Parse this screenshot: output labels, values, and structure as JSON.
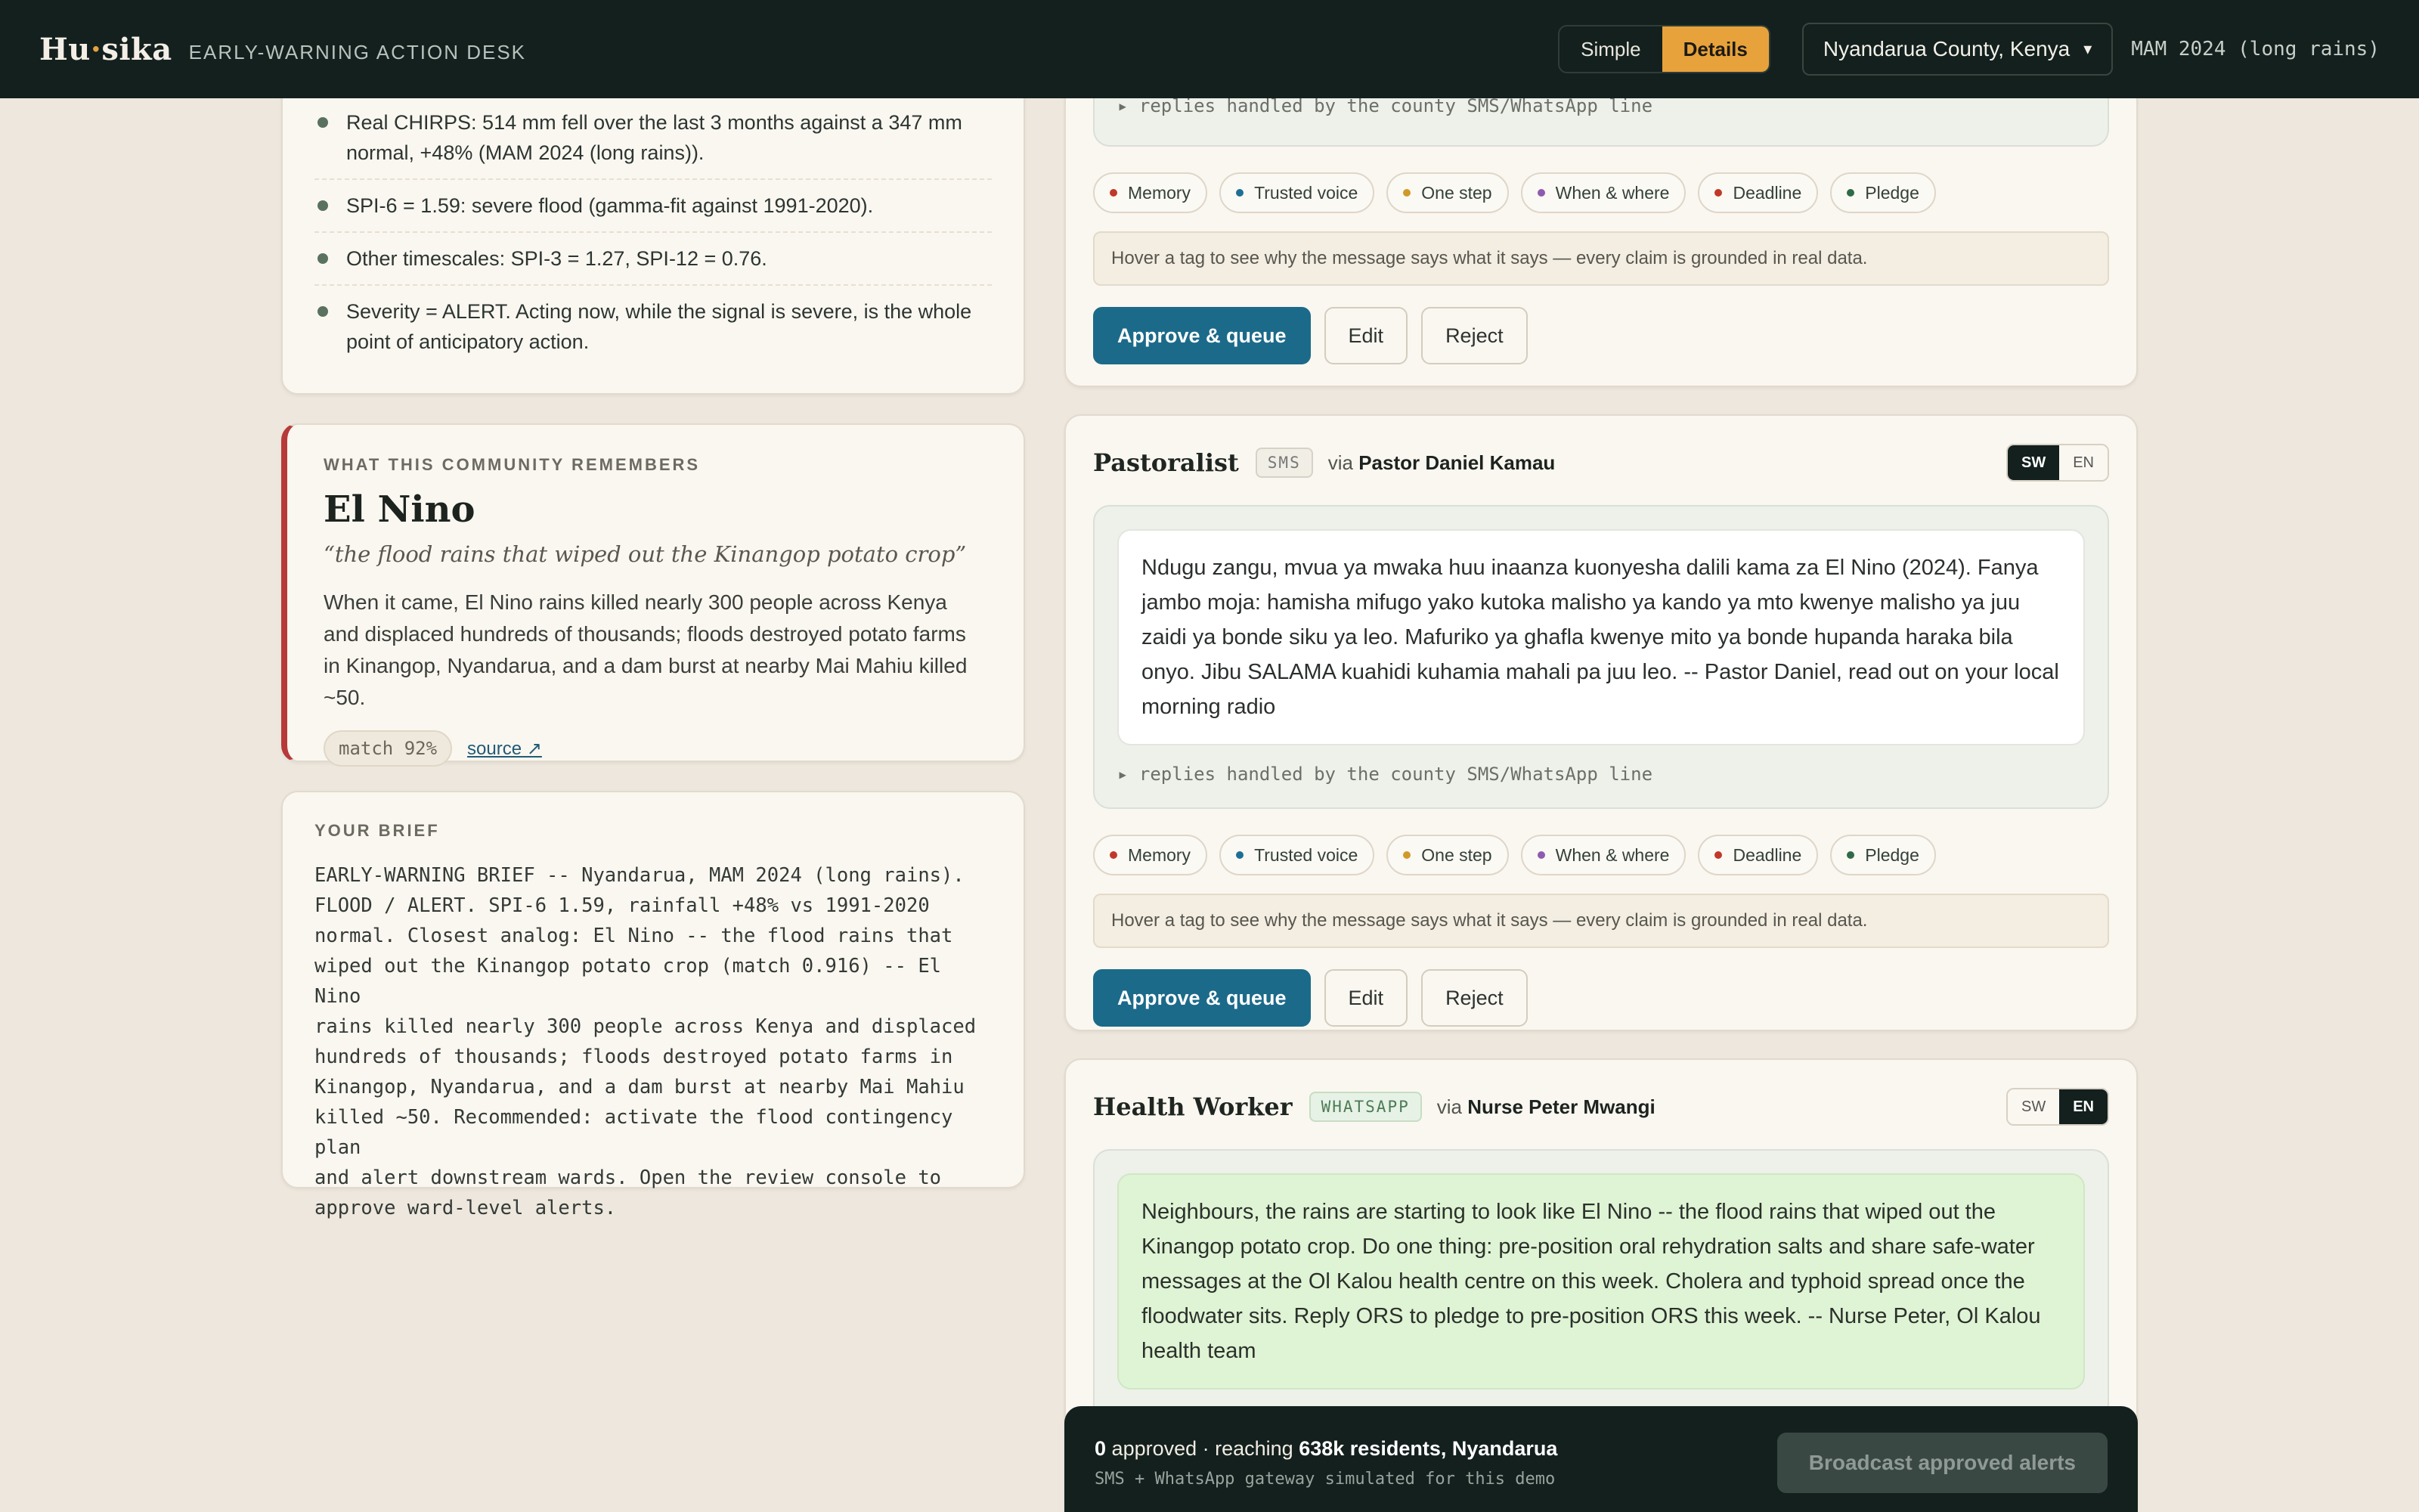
{
  "topbar": {
    "logo_a": "Hu",
    "logo_dot": "·",
    "logo_b": "sika",
    "subtitle": "EARLY-WARNING ACTION DESK",
    "mode_simple": "Simple",
    "mode_details": "Details",
    "region": "Nyandarua County, Kenya",
    "season": "MAM 2024 (long rains)"
  },
  "facts": [
    "Real CHIRPS: 514 mm fell over the last 3 months against a 347 mm normal, +48% (MAM 2024 (long rains)).",
    "SPI-6 = 1.59: severe flood (gamma-fit against 1991-2020).",
    "Other timescales: SPI-3 = 1.27, SPI-12 = 0.76.",
    "Severity = ALERT. Acting now, while the signal is severe, is the whole point of anticipatory action."
  ],
  "memory": {
    "kicker": "WHAT THIS COMMUNITY REMEMBERS",
    "title": "El Nino",
    "quote": "“the flood rains that wiped out the Kinangop potato crop”",
    "body": "When it came, El Nino rains killed nearly 300 people across Kenya and displaced hundreds of thousands; floods destroyed potato farms in Kinangop, Nyandarua, and a dam burst at nearby Mai Mahiu killed ~50.",
    "match": "match 92%",
    "source": "source ↗"
  },
  "brief": {
    "kicker": "YOUR BRIEF",
    "text": "EARLY-WARNING BRIEF -- Nyandarua, MAM 2024 (long rains).\nFLOOD / ALERT. SPI-6 1.59, rainfall +48% vs 1991-2020\nnormal. Closest analog: El Nino -- the flood rains that\nwiped out the Kinangop potato crop (match 0.916) -- El Nino\nrains killed nearly 300 people across Kenya and displaced\nhundreds of thousands; floods destroyed potato farms in\nKinangop, Nyandarua, and a dam burst at nearby Mai Mahiu\nkilled ~50. Recommended: activate the flood contingency plan\nand alert downstream wards. Open the review console to\napprove ward-level alerts."
  },
  "common": {
    "replies": "▸ replies handled by the county SMS/WhatsApp line",
    "hint": "Hover a tag to see why the message says what it says — every claim is grounded in real data.",
    "approve": "Approve & queue",
    "edit": "Edit",
    "reject": "Reject",
    "via": "via",
    "lang_sw": "SW",
    "lang_en": "EN",
    "tags": [
      {
        "label": "Memory",
        "color": "#c0392b"
      },
      {
        "label": "Trusted voice",
        "color": "#1f6f95"
      },
      {
        "label": "One step",
        "color": "#d09a2a"
      },
      {
        "label": "When & where",
        "color": "#8e5bb0"
      },
      {
        "label": "Deadline",
        "color": "#c0392b"
      },
      {
        "label": "Pledge",
        "color": "#2e6b4a"
      }
    ]
  },
  "pastoralist": {
    "role": "Pastoralist",
    "channel": "SMS",
    "messenger": "Pastor Daniel Kamau",
    "message": "Ndugu zangu, mvua ya mwaka huu inaanza kuonyesha dalili kama za El Nino (2024). Fanya jambo moja: hamisha mifugo yako kutoka malisho ya kando ya mto kwenye malisho ya juu zaidi ya bonde siku ya leo. Mafuriko ya ghafla kwenye mito ya bonde hupanda haraka bila onyo. Jibu SALAMA kuahidi kuhamia mahali pa juu leo. -- Pastor Daniel, read out on your local morning radio"
  },
  "health": {
    "role": "Health Worker",
    "channel": "WHATSAPP",
    "messenger": "Nurse Peter Mwangi",
    "message": "Neighbours, the rains are starting to look like El Nino -- the flood rains that wiped out the Kinangop potato crop. Do one thing: pre-position oral rehydration salts and share safe-water messages at the Ol Kalou health centre on this week. Cholera and typhoid spread once the floodwater sits. Reply ORS to pledge to pre-position ORS this week. -- Nurse Peter, Ol Kalou health team"
  },
  "footer": {
    "count": "0",
    "approved": "approved · reaching",
    "reach": "638k residents, Nyandarua",
    "note": "SMS + WhatsApp gateway simulated for this demo",
    "broadcast": "Broadcast approved alerts"
  }
}
